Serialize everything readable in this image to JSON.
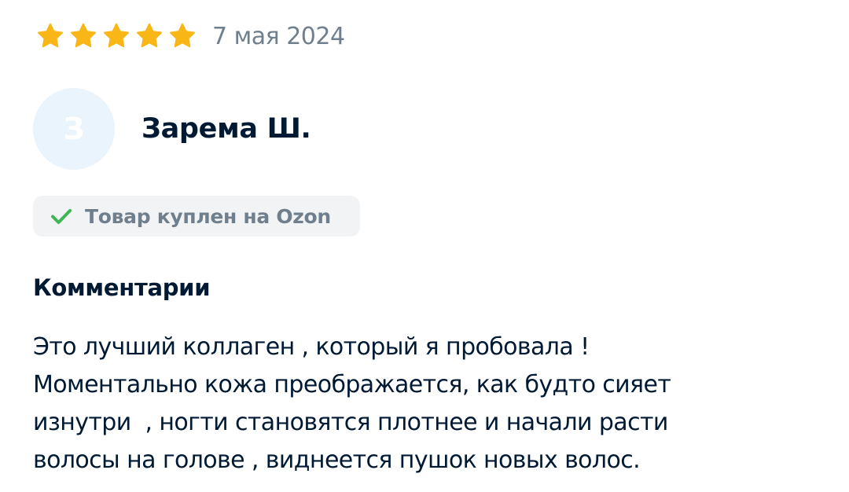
{
  "review": {
    "rating": 5,
    "rating_max": 5,
    "star_color": "#f9b617",
    "date": "7 мая 2024",
    "author": {
      "initial": "З",
      "name": "Зарема Ш."
    },
    "badge": {
      "icon": "check-icon",
      "text": "Товар куплен на Ozon",
      "icon_color": "#3fb554"
    },
    "comment_title": "Комментарии",
    "comment_lines": [
      "Это лучший коллаген , который я пробовала !",
      "Моментально кожа преображается, как будто сияет",
      "изнутри  , ногти становятся плотнее и начали расти",
      "волосы на голове , виднеется пушок новых волос."
    ]
  }
}
